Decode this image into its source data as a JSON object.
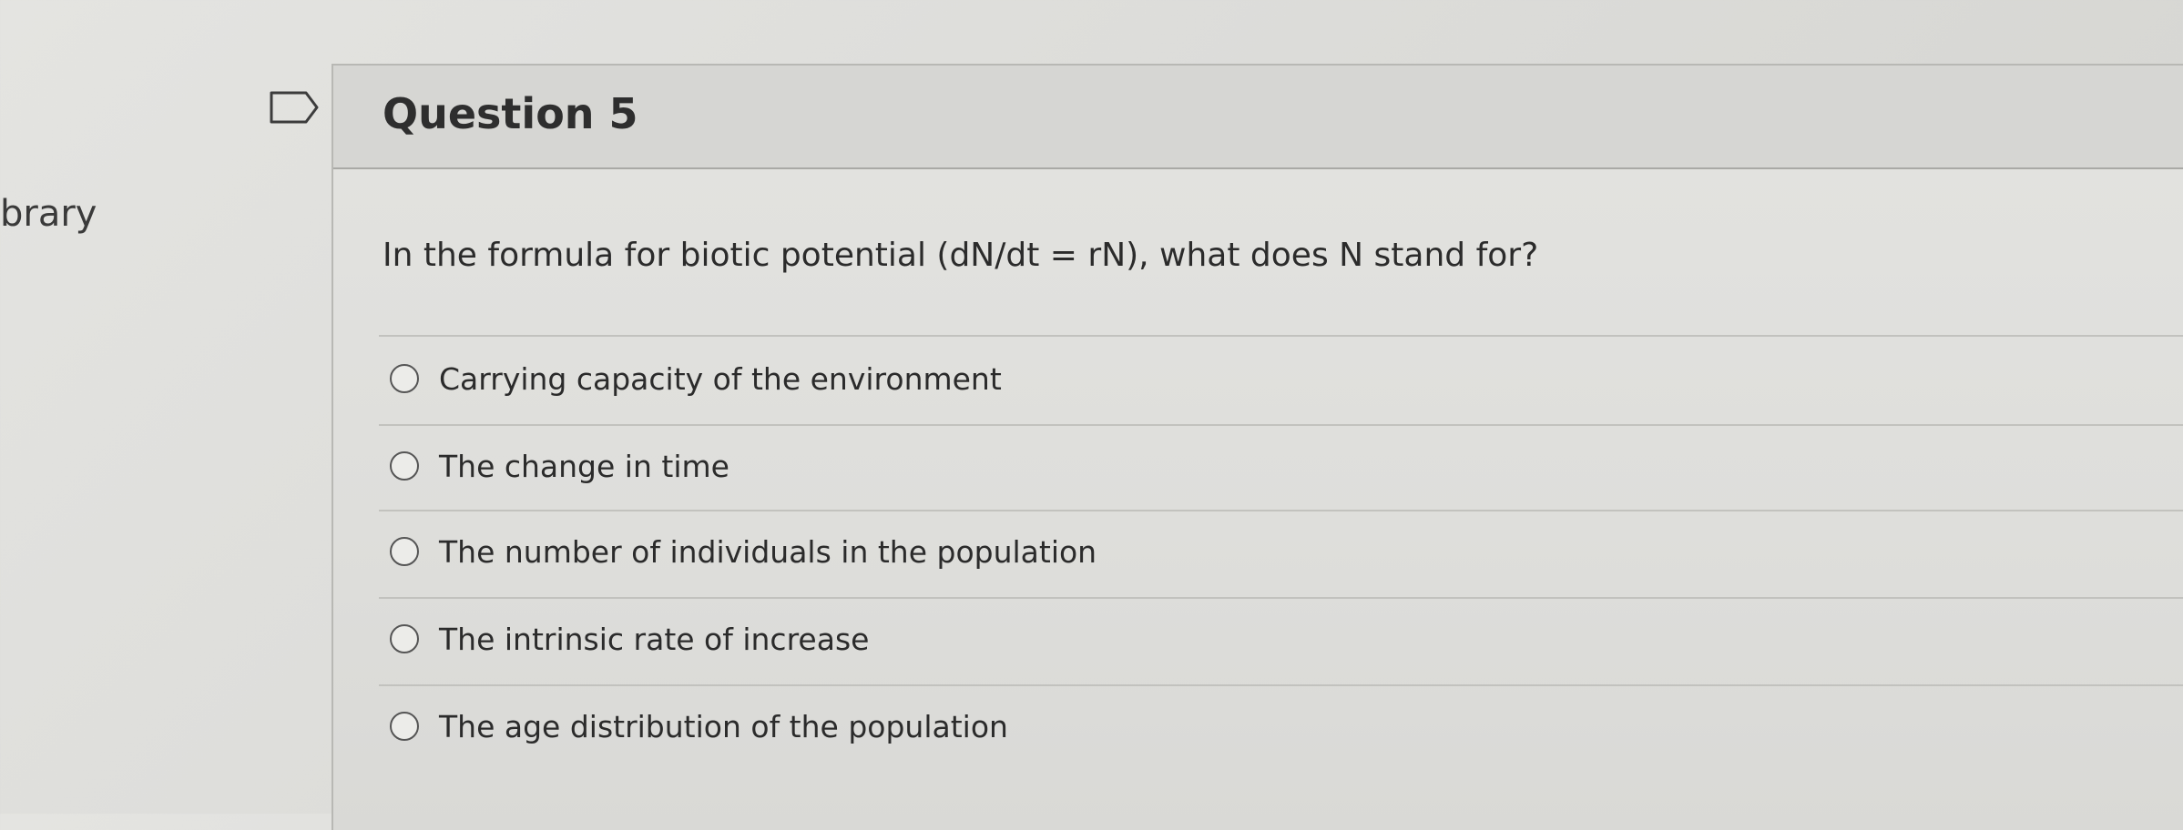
{
  "sidebar": {
    "partial_label": "brary"
  },
  "question": {
    "title": "Question 5",
    "text": "In the formula for biotic potential (dN/dt = rN), what does N stand for?",
    "options": [
      {
        "label": "Carrying capacity of the environment"
      },
      {
        "label": "The change in time"
      },
      {
        "label": "The number of individuals in the population"
      },
      {
        "label": "The intrinsic rate of increase"
      },
      {
        "label": "The age distribution of the population"
      }
    ]
  },
  "icons": {
    "flag": "flag-icon",
    "radio": "radio-icon"
  },
  "colors": {
    "background": "#dcdcd9",
    "header_band": "#d6d6d3",
    "text": "#2b2b2b"
  }
}
